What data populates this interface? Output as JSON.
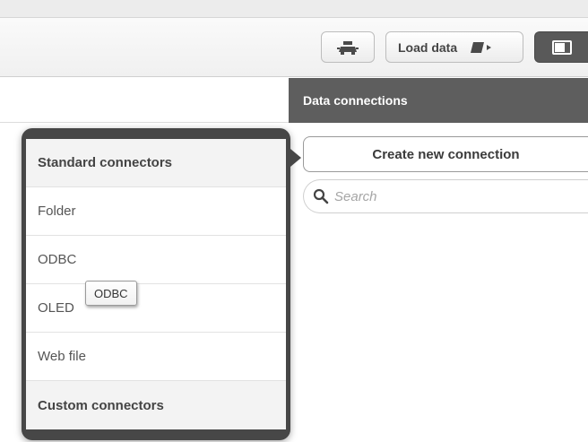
{
  "toolbar": {
    "debug_icon": "debug-bug-icon",
    "load_data_label": "Load data",
    "load_data_icon": "load-data-icon",
    "panel_icon": "panel-toggle-icon"
  },
  "data_connections": {
    "title": "Data connections",
    "create_label": "Create new connection",
    "search_placeholder": "Search",
    "search_icon": "search-icon"
  },
  "connector_menu": {
    "items": [
      {
        "label": "Standard connectors",
        "kind": "header"
      },
      {
        "label": "Folder",
        "kind": "item"
      },
      {
        "label": "ODBC",
        "kind": "item"
      },
      {
        "label": "OLED",
        "kind": "item"
      },
      {
        "label": "Web file",
        "kind": "item"
      },
      {
        "label": "Custom connectors",
        "kind": "header"
      }
    ]
  },
  "tooltip": {
    "text": "ODBC"
  },
  "colors": {
    "panel_header": "#5e5e5e",
    "popover_border": "#474747",
    "toolbar_button_active": "#595959"
  }
}
